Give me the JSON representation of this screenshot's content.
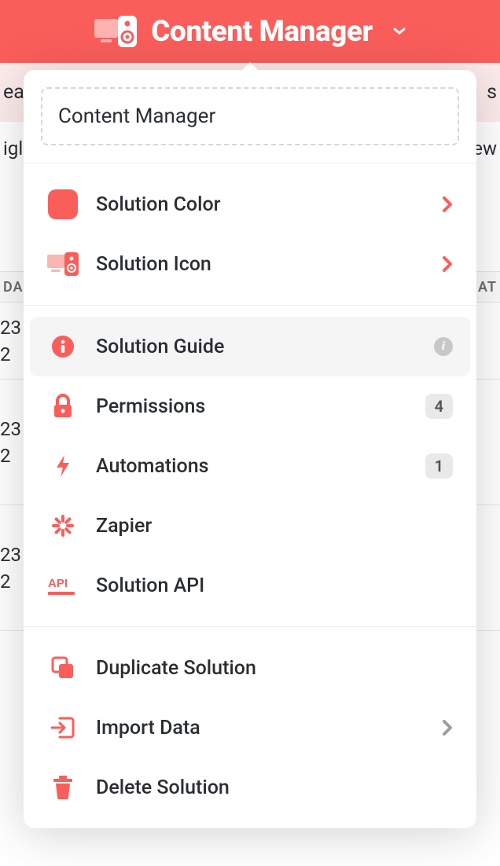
{
  "header": {
    "title": "Content Manager"
  },
  "subheader": {
    "left": "ea",
    "right": "s"
  },
  "strip": {
    "left": "igl",
    "right": "ew"
  },
  "colheader": {
    "left": "DA",
    "right": "AT"
  },
  "rows": [
    {
      "a": "23",
      "b": "2"
    },
    {
      "a": "23",
      "b": "2"
    },
    {
      "a": "23",
      "b": "2"
    }
  ],
  "popover": {
    "name_value": "Content Manager",
    "section1": {
      "color_label": "Solution Color",
      "icon_label": "Solution Icon"
    },
    "section2": {
      "guide_label": "Solution Guide",
      "permissions_label": "Permissions",
      "permissions_count": "4",
      "automations_label": "Automations",
      "automations_count": "1",
      "zapier_label": "Zapier",
      "api_label": "Solution API"
    },
    "section3": {
      "duplicate_label": "Duplicate Solution",
      "import_label": "Import Data",
      "delete_label": "Delete Solution"
    }
  }
}
